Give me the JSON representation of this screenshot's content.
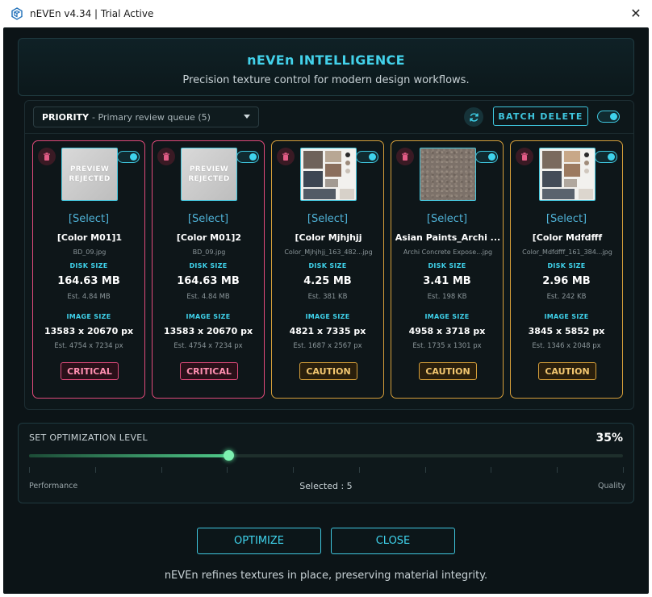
{
  "titlebar": {
    "title": "nEVEn v4.34 | Trial Active",
    "close_icon": "close-icon"
  },
  "header": {
    "title": "nEVEn INTELLIGENCE",
    "subtitle": "Precision texture control for modern design workflows."
  },
  "toolbar": {
    "dropdown_key": "PRIORITY",
    "dropdown_value": "- Primary review queue (5)",
    "batch_delete_label": "BATCH DELETE",
    "toggle_on": true
  },
  "cards": [
    {
      "select": "[Select]",
      "name": "[Color M01]1",
      "file": "BD_09.jpg",
      "disk_label": "DISK SIZE",
      "disk": "164.63 MB",
      "disk_est": "Est. 4.84 MB",
      "image_label": "IMAGE SIZE",
      "image": "13583 x 20670 px",
      "image_est": "Est. 4754 x 7234 px",
      "status": "CRITICAL",
      "preview": "PREVIEW REJECTED",
      "enabled": true
    },
    {
      "select": "[Select]",
      "name": "[Color M01]2",
      "file": "BD_09.jpg",
      "disk_label": "DISK SIZE",
      "disk": "164.63 MB",
      "disk_est": "Est. 4.84 MB",
      "image_label": "IMAGE SIZE",
      "image": "13583 x 20670 px",
      "image_est": "Est. 4754 x 7234 px",
      "status": "CRITICAL",
      "preview": "PREVIEW REJECTED",
      "enabled": true
    },
    {
      "select": "[Select]",
      "name": "[Color Mjhjhjj",
      "file": "Color_Mjhjhjj_163_482...jpg",
      "disk_label": "DISK SIZE",
      "disk": "4.25 MB",
      "disk_est": "Est. 381 KB",
      "image_label": "IMAGE SIZE",
      "image": "4821 x 7335 px",
      "image_est": "Est. 1687 x 2567 px",
      "status": "CAUTION",
      "enabled": true
    },
    {
      "select": "[Select]",
      "name": "Asian Paints_Archi ...",
      "file": "Archi Concrete Expose...jpg",
      "disk_label": "DISK SIZE",
      "disk": "3.41 MB",
      "disk_est": "Est. 198 KB",
      "image_label": "IMAGE SIZE",
      "image": "4958 x 3718 px",
      "image_est": "Est. 1735 x 1301 px",
      "status": "CAUTION",
      "enabled": true
    },
    {
      "select": "[Select]",
      "name": "[Color Mdfdfff",
      "file": "Color_Mdfdfff_161_384...jpg",
      "disk_label": "DISK SIZE",
      "disk": "2.96 MB",
      "disk_est": "Est. 242 KB",
      "image_label": "IMAGE SIZE",
      "image": "3845 x 5852 px",
      "image_est": "Est. 1346 x 2048 px",
      "status": "CAUTION",
      "enabled": true
    }
  ],
  "optimization": {
    "title": "SET OPTIMIZATION LEVEL",
    "percent_label": "35%",
    "level": 0.335,
    "left_label": "Performance",
    "selected": "Selected : 5",
    "right_label": "Quality"
  },
  "actions": {
    "optimize": "OPTIMIZE",
    "close": "CLOSE"
  },
  "footer": "nEVEn refines textures in place, preserving material integrity.",
  "colors": {
    "accent": "#3fd3ec",
    "critical": "#e04a7a",
    "caution": "#d69f3a",
    "slider": "#4fc889"
  }
}
